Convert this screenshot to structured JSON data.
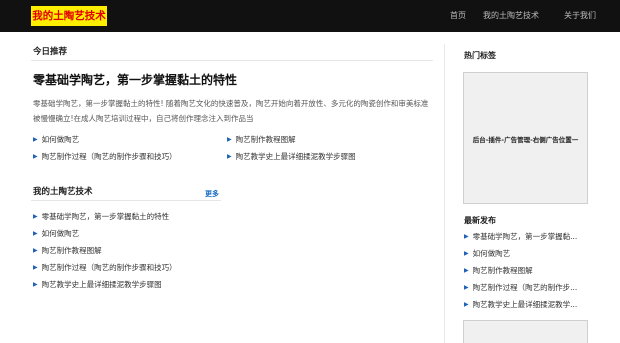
{
  "site": {
    "logo_text": "我的土陶艺技术"
  },
  "nav": {
    "items": [
      "首页",
      "我的土陶艺技术",
      "关于我们"
    ]
  },
  "today": {
    "section_title": "今日推荐",
    "headline": "零基础学陶艺，第一步掌握黏土的特性",
    "excerpt": "零基础学陶艺，第一步掌握黏土的特性! 随着陶艺文化的快速普及，陶艺开始向着开放性、多元化的陶瓷创作和审美标准被慢慢确立!在成人陶艺培训过程中，自己将创作理念注入到作品当",
    "links_left": [
      "如何做陶艺",
      "陶艺制作过程（陶艺的制作步骤和技巧）"
    ],
    "links_right": [
      "陶艺制作教程图解",
      "陶艺教学史上最详细揉泥教学步骤图"
    ]
  },
  "category": {
    "section_title": "我的土陶艺技术",
    "more_label": "更多",
    "links": [
      "零基础学陶艺，第一步掌握黏土的特性",
      "如何做陶艺",
      "陶艺制作教程图解",
      "陶艺制作过程（陶艺的制作步骤和技巧）",
      "陶艺教学史上最详细揉泥教学步骤图"
    ]
  },
  "sidebar": {
    "tags_title": "热门标签",
    "ad_text": "后台-插件-广告管理-右侧广告位置一",
    "recent_title": "最新发布",
    "recent_links": [
      "零基础学陶艺，第一步掌握黏...",
      "如何做陶艺",
      "陶艺制作教程图解",
      "陶艺制作过程（陶艺的制作步...",
      "陶艺教学史上最详细揉泥教学..."
    ]
  },
  "colors": {
    "topbar": "#111111",
    "logo_bg": "#ffee00",
    "logo_text": "#e00000",
    "accent": "#1e6fc8"
  }
}
